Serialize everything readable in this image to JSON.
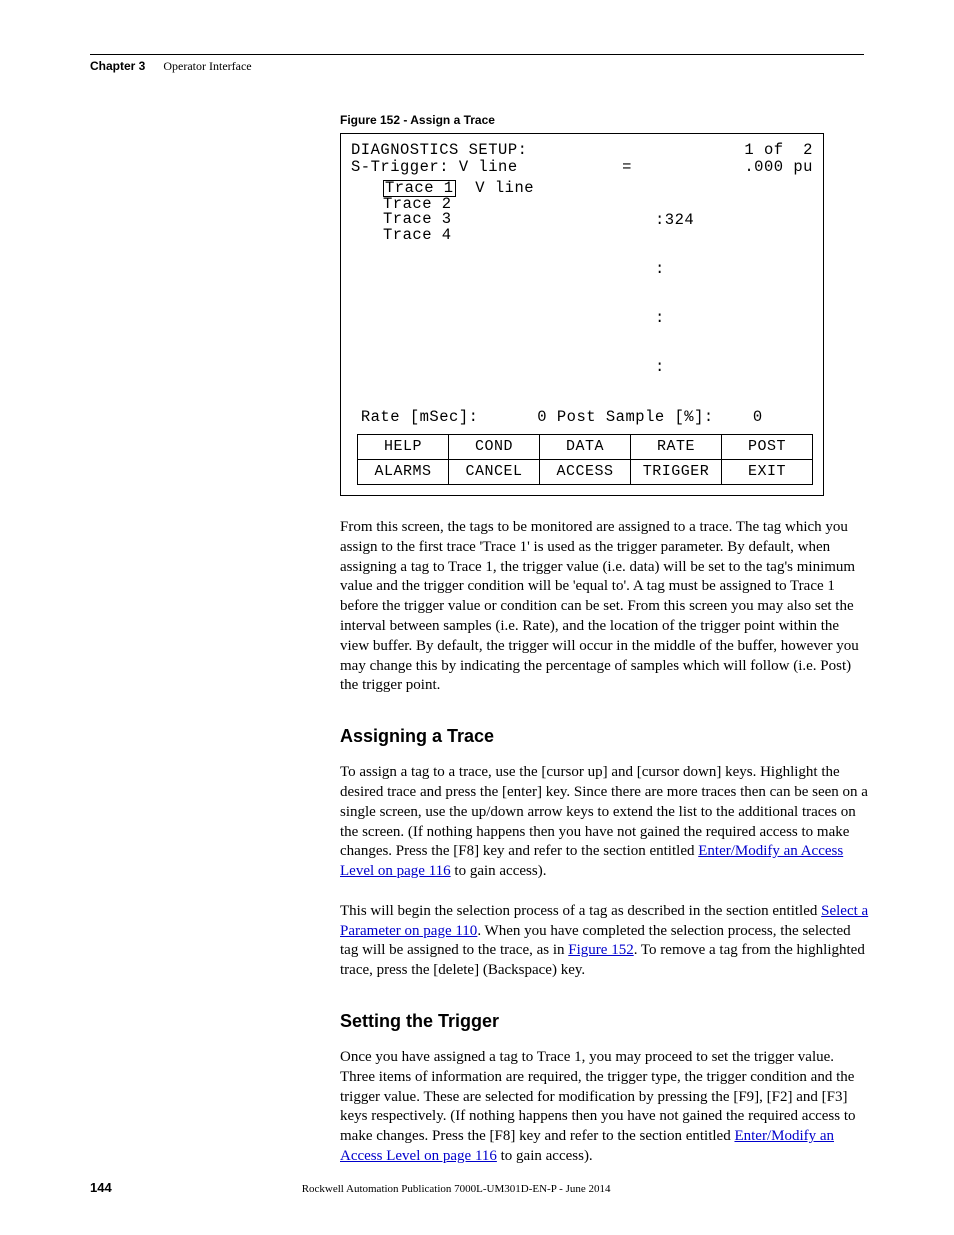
{
  "header": {
    "chapter": "Chapter 3",
    "title": "Operator Interface"
  },
  "figure": {
    "caption": "Figure 152 - Assign a Trace",
    "title_left": "DIAGNOSTICS SETUP:",
    "title_right": "1 of  2",
    "trigger_left": "S-Trigger: V line",
    "trigger_eq": "=",
    "trigger_val": ".000 pu",
    "trace1_label": "Trace 1",
    "trace1_tag": "V line",
    "trace1_id": "324",
    "trace2_label": "Trace 2",
    "trace3_label": "Trace 3",
    "trace4_label": "Trace 4",
    "rate_label": "Rate [mSec]:",
    "rate_val": "0",
    "post_label": "Post Sample [%]:",
    "post_val": "0",
    "fkeys_row1": [
      "HELP",
      "COND",
      "DATA",
      "RATE",
      "POST"
    ],
    "fkeys_row2": [
      "ALARMS",
      "CANCEL",
      "ACCESS",
      "TRIGGER",
      "EXIT"
    ]
  },
  "paragraphs": {
    "p1": "From this screen, the tags to be monitored are assigned to a trace. The tag which you assign to the first trace 'Trace 1' is used as the trigger parameter. By default, when assigning a tag to Trace 1, the trigger value (i.e. data) will be set to the tag's minimum value and the trigger condition will be 'equal to'. A tag must be assigned to Trace 1 before the trigger value or condition can be set. From this screen you may also set the interval between samples (i.e. Rate), and the location of the trigger point within the view buffer. By default, the trigger will occur in the middle of the buffer, however you may change this by indicating the percentage of samples which will follow (i.e. Post) the trigger point.",
    "h_assign": "Assigning a Trace",
    "p2a": "To assign a tag to a trace, use the [cursor up] and [cursor down] keys. Highlight the desired trace and press the [enter] key. Since there are more traces then can be seen on a single screen, use the up/down arrow keys to extend the list to the additional traces on the screen. (If nothing happens then you have not gained the required access to make changes. Press the [F8] key and refer to the section entitled ",
    "p2_link": "Enter/Modify an Access Level  on page 116",
    "p2b": " to gain access).",
    "p3a": "This will begin the selection process of a tag as described in the section entitled ",
    "p3_link1": "Select a Parameter on page 110",
    "p3b": ". When you have completed the selection process, the selected tag will be assigned to the trace, as in ",
    "p3_link2": "Figure 152",
    "p3c": ". To remove a tag from the highlighted trace, press the [delete] (Backspace) key.",
    "h_trigger": "Setting the Trigger",
    "p4a": "Once you have assigned a tag to Trace 1, you may proceed to set the trigger value. Three items of information are required, the trigger type, the trigger condition and the trigger value. These are selected for modification by pressing the [F9], [F2] and [F3] keys respectively.  (If nothing happens then you have not gained the required access to make changes. Press the [F8] key and refer to the section entitled ",
    "p4_link": "Enter/Modify an Access Level  on page 116",
    "p4b": " to gain access)."
  },
  "footer": {
    "page": "144",
    "pub": "Rockwell Automation Publication 7000L-UM301D-EN-P - June 2014"
  }
}
